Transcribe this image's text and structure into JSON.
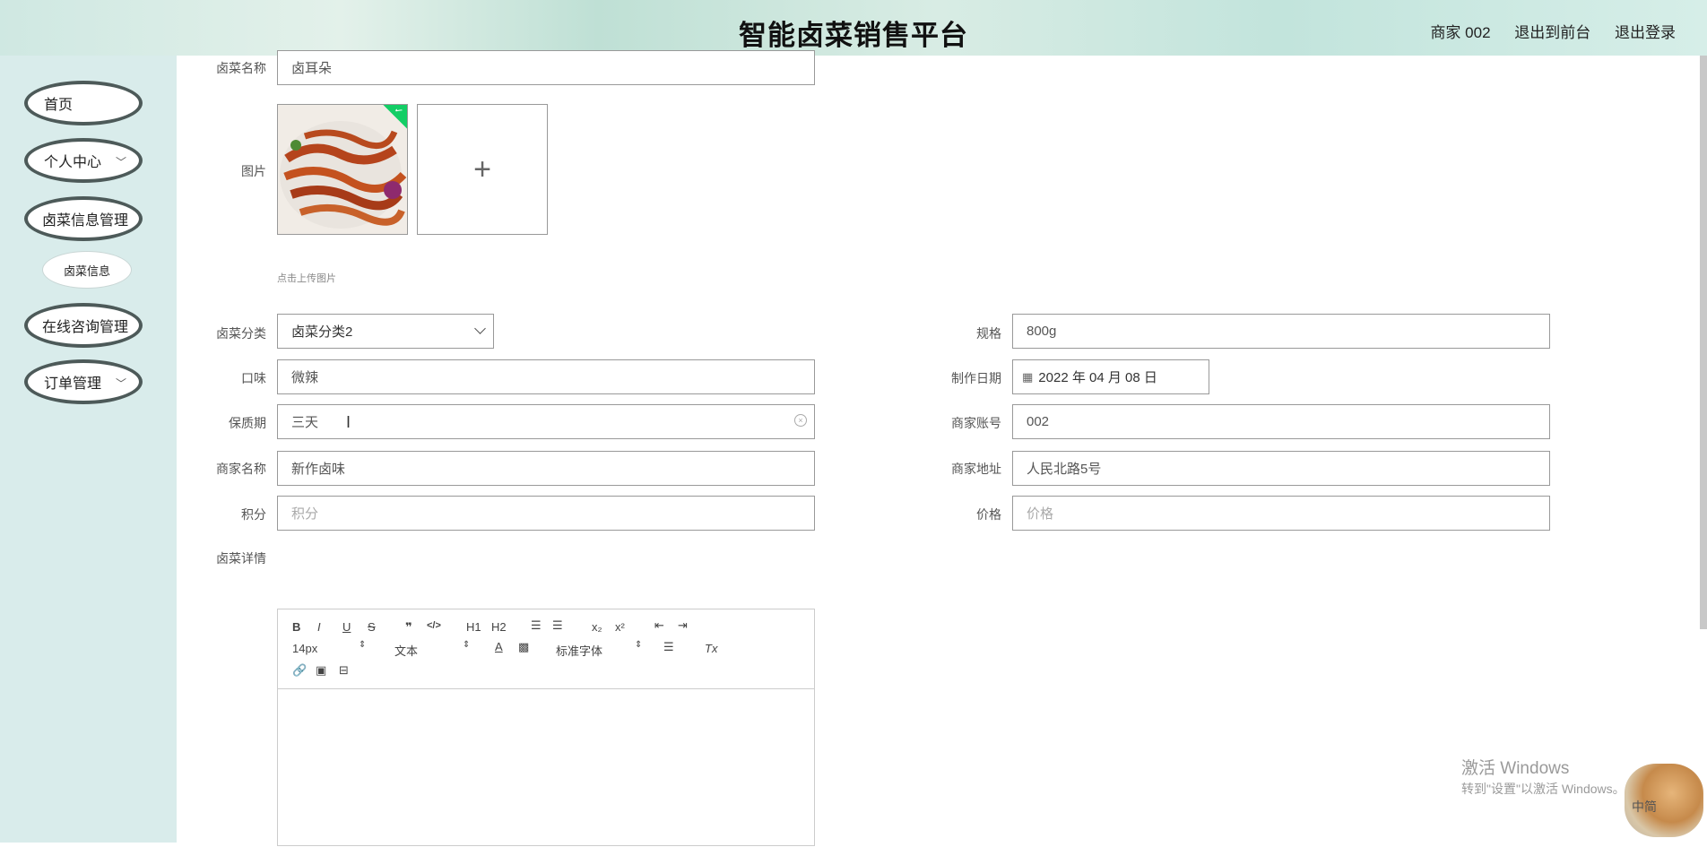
{
  "header": {
    "title": "智能卤菜销售平台",
    "user": "商家 002",
    "back_to_front": "退出到前台",
    "logout": "退出登录"
  },
  "sidebar": {
    "items": [
      {
        "label": "首页",
        "chevron": false
      },
      {
        "label": "个人中心",
        "chevron": true
      },
      {
        "label": "卤菜信息管理",
        "chevron": false
      },
      {
        "label": "卤菜信息",
        "sub": true
      },
      {
        "label": "在线咨询管理",
        "chevron": false
      },
      {
        "label": "订单管理",
        "chevron": true
      }
    ]
  },
  "form": {
    "name": {
      "label": "卤菜名称",
      "value": "卤耳朵"
    },
    "image": {
      "label": "图片",
      "hint": "点击上传图片",
      "add": "+"
    },
    "category": {
      "label": "卤菜分类",
      "value": "卤菜分类2"
    },
    "spec": {
      "label": "规格",
      "value": "800g"
    },
    "taste": {
      "label": "口味",
      "value": "微辣"
    },
    "date": {
      "label": "制作日期",
      "value": "2022 年 04 月 08 日",
      "icon": "calendar-icon"
    },
    "shelf_life": {
      "label": "保质期",
      "value": "三天"
    },
    "merchant_account": {
      "label": "商家账号",
      "value": "002"
    },
    "merchant_name": {
      "label": "商家名称",
      "value": "新作卤味"
    },
    "merchant_address": {
      "label": "商家地址",
      "value": "人民北路5号"
    },
    "points": {
      "label": "积分",
      "placeholder": "积分"
    },
    "price": {
      "label": "价格",
      "placeholder": "价格"
    },
    "details": {
      "label": "卤菜详情"
    }
  },
  "editor": {
    "font_size": "14px",
    "text_style": "文本",
    "font_family": "标准字体",
    "h1": "H1",
    "h2": "H2",
    "bold": "B",
    "italic": "I",
    "underline": "U",
    "strike": "S",
    "quote": "❞",
    "code": "</>",
    "sub": "x₂",
    "sup": "x²",
    "clear_format": "Tx",
    "color": "A"
  },
  "watermark": {
    "line1": "激活 Windows",
    "line2": "转到\"设置\"以激活 Windows。"
  },
  "ime_label": "中简"
}
